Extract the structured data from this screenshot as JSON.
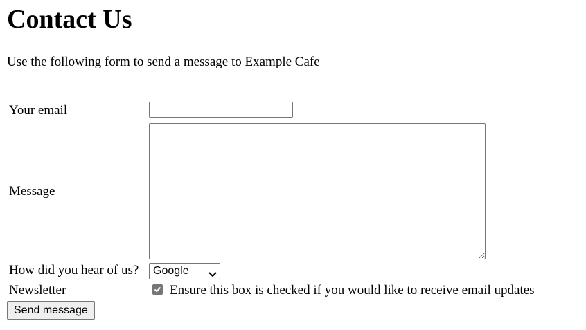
{
  "page": {
    "title": "Contact Us",
    "intro": "Use the following form to send a message to Example Cafe"
  },
  "form": {
    "email": {
      "label": "Your email",
      "value": "",
      "placeholder": ""
    },
    "message": {
      "label": "Message",
      "value": ""
    },
    "referral": {
      "label": "How did you hear of us?",
      "selected": "Google"
    },
    "newsletter": {
      "label": "Newsletter",
      "checked": true,
      "description": "Ensure this box is checked if you would like to receive email updates"
    },
    "submit_label": "Send message"
  },
  "icons": {
    "select_chevron": "chevron-down-icon",
    "checkbox_check": "checkmark-icon"
  },
  "colors": {
    "border": "#767676",
    "button_bg": "#efefef",
    "checkbox_fill": "#767676"
  }
}
